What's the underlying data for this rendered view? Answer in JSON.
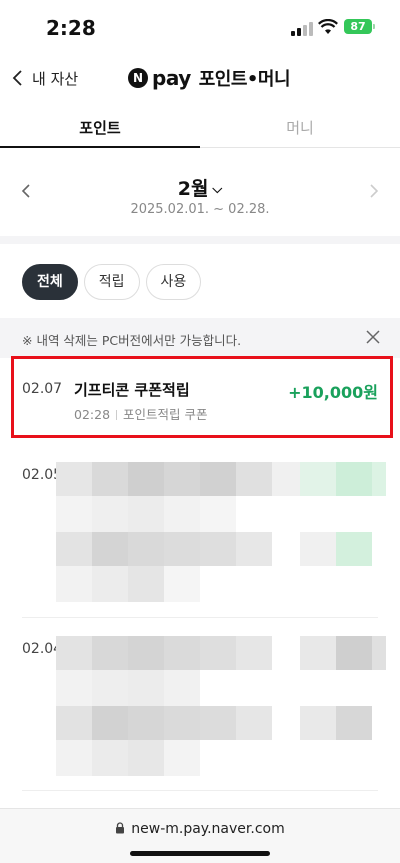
{
  "status": {
    "time": "2:28",
    "battery": "87"
  },
  "header": {
    "back_label": "내 자산",
    "logo_letter": "N",
    "pay_word": "pay",
    "title": "포인트•머니"
  },
  "tabs": [
    {
      "label": "포인트",
      "active": true
    },
    {
      "label": "머니",
      "active": false
    }
  ],
  "month": {
    "title": "2월",
    "range": "2025.02.01. ~ 02.28."
  },
  "filters": [
    {
      "label": "전체",
      "active": true
    },
    {
      "label": "적립",
      "active": false
    },
    {
      "label": "사용",
      "active": false
    }
  ],
  "notice": {
    "text": "※ 내역 삭제는 PC버전에서만 가능합니다."
  },
  "transactions": [
    {
      "date": "02.07",
      "title": "기프티콘 쿠폰적립",
      "time": "02:28",
      "category": "포인트적립 쿠폰",
      "amount": "+10,000원"
    },
    {
      "date": "02.05"
    },
    {
      "date": "02.04"
    }
  ],
  "browser": {
    "url": "new-m.pay.naver.com"
  },
  "colors": {
    "accent_green": "#1aa15c",
    "highlight_red": "#e8101a",
    "chip_active": "#2a3139"
  }
}
